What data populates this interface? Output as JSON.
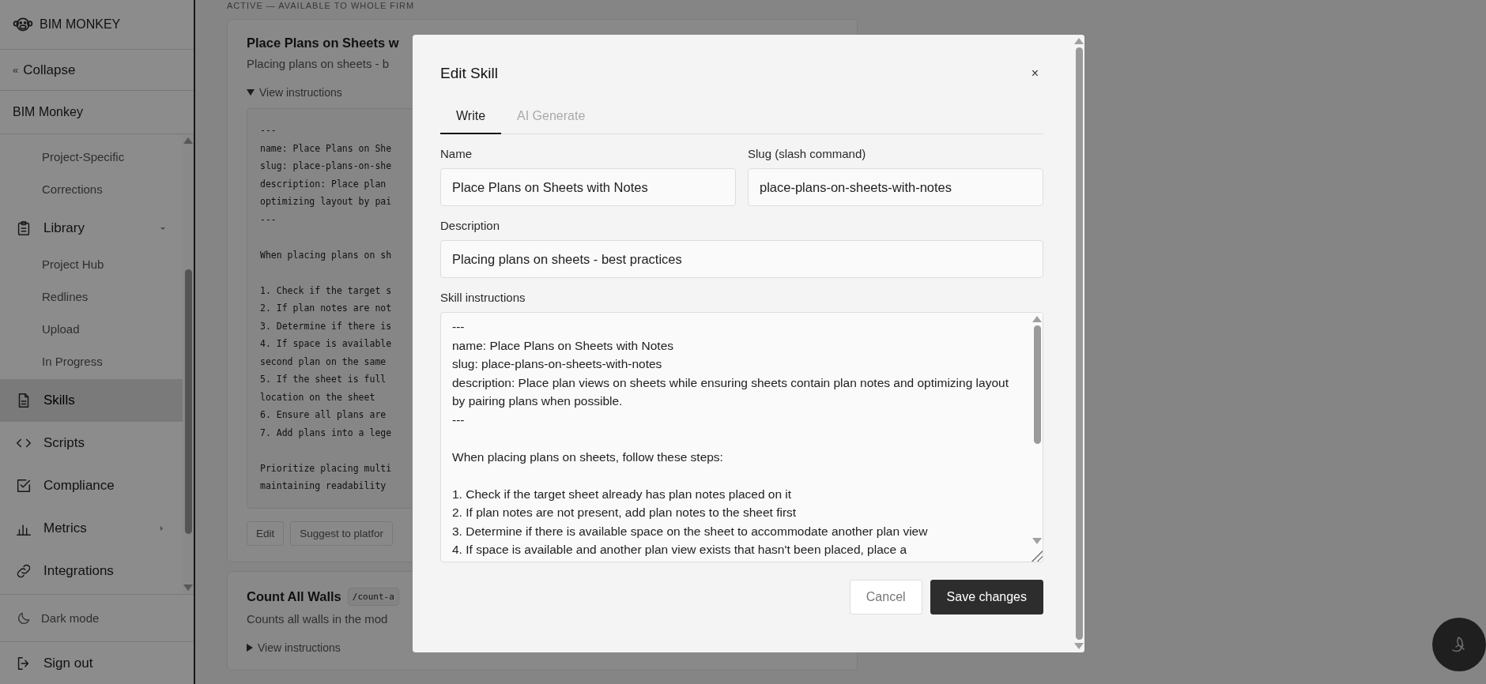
{
  "sidebar": {
    "brand": "BIM MONKEY",
    "collapse": {
      "icon": "«",
      "label": "Collapse"
    },
    "workspace": "BIM Monkey",
    "nav": [
      {
        "kind": "sub",
        "label": "Project-Specific",
        "selected": false
      },
      {
        "kind": "sub",
        "label": "Corrections",
        "selected": false
      },
      {
        "kind": "main",
        "label": "Library",
        "selected": false,
        "expanded": true
      },
      {
        "kind": "sub",
        "label": "Project Hub",
        "selected": false
      },
      {
        "kind": "sub",
        "label": "Redlines",
        "selected": false
      },
      {
        "kind": "sub",
        "label": "Upload",
        "selected": false
      },
      {
        "kind": "sub",
        "label": "In Progress",
        "selected": false
      },
      {
        "kind": "main",
        "label": "Skills",
        "selected": true
      },
      {
        "kind": "main",
        "label": "Scripts",
        "selected": false
      },
      {
        "kind": "main",
        "label": "Compliance",
        "selected": false
      },
      {
        "kind": "main",
        "label": "Metrics",
        "selected": false,
        "expanded": false
      },
      {
        "kind": "main",
        "label": "Integrations",
        "selected": false
      }
    ],
    "dark_mode": "Dark mode",
    "sign_out": "Sign out"
  },
  "main": {
    "section_heading": "ACTIVE — AVAILABLE TO WHOLE FIRM",
    "cards": [
      {
        "title": "Place Plans on Sheets w",
        "description": "Placing plans on sheets - b",
        "expanded": true,
        "toggle": "View instructions",
        "blocks": [
          [
            "---",
            "name: Place Plans on She",
            "slug: place-plans-on-she",
            "description: Place plan",
            "optimizing layout by pai",
            "---"
          ],
          [
            "When placing plans on sh"
          ],
          [
            "1. Check if the target s",
            "2. If plan notes are not",
            "3. Determine if there is",
            "4. If space is available",
            "second plan on the same",
            "5. If the sheet is full",
            "location on the sheet",
            "6. Ensure all plans are",
            "7. Add plans into a lege"
          ],
          [
            "Prioritize placing multi",
            "maintaining readability"
          ]
        ],
        "buttons": [
          "Edit",
          "Suggest to platfor"
        ]
      },
      {
        "title": "Count All Walls",
        "slug": "/count-a",
        "description": "Counts all walls in the mod",
        "expanded": false,
        "toggle": "View instructions"
      }
    ]
  },
  "modal": {
    "title": "Edit Skill",
    "close": "×",
    "tabs": [
      {
        "label": "Write",
        "selected": true
      },
      {
        "label": "AI Generate",
        "selected": false
      }
    ],
    "name": {
      "label": "Name",
      "value": "Place Plans on Sheets with Notes"
    },
    "slug": {
      "label": "Slug (slash command)",
      "value": "place-plans-on-sheets-with-notes"
    },
    "description": {
      "label": "Description",
      "value": "Placing plans on sheets - best practices"
    },
    "instructions": {
      "label": "Skill instructions",
      "blocks": [
        [
          "---",
          "name: Place Plans on Sheets with Notes",
          "slug: place-plans-on-sheets-with-notes",
          "description: Place plan views on sheets while ensuring sheets contain plan notes and optimizing layout by pairing plans when possible.",
          "---"
        ],
        [
          "When placing plans on sheets, follow these steps:"
        ],
        [
          "1. Check if the target sheet already has plan notes placed on it",
          "2. If plan notes are not present, add plan notes to the sheet first",
          "3. Determine if there is available space on the sheet to accommodate another plan view",
          "4. If space is available and another plan view exists that hasn't been placed, place a"
        ]
      ]
    },
    "buttons": [
      {
        "kind": "secondary",
        "label": "Cancel"
      },
      {
        "kind": "primary",
        "label": "Save changes"
      }
    ]
  }
}
